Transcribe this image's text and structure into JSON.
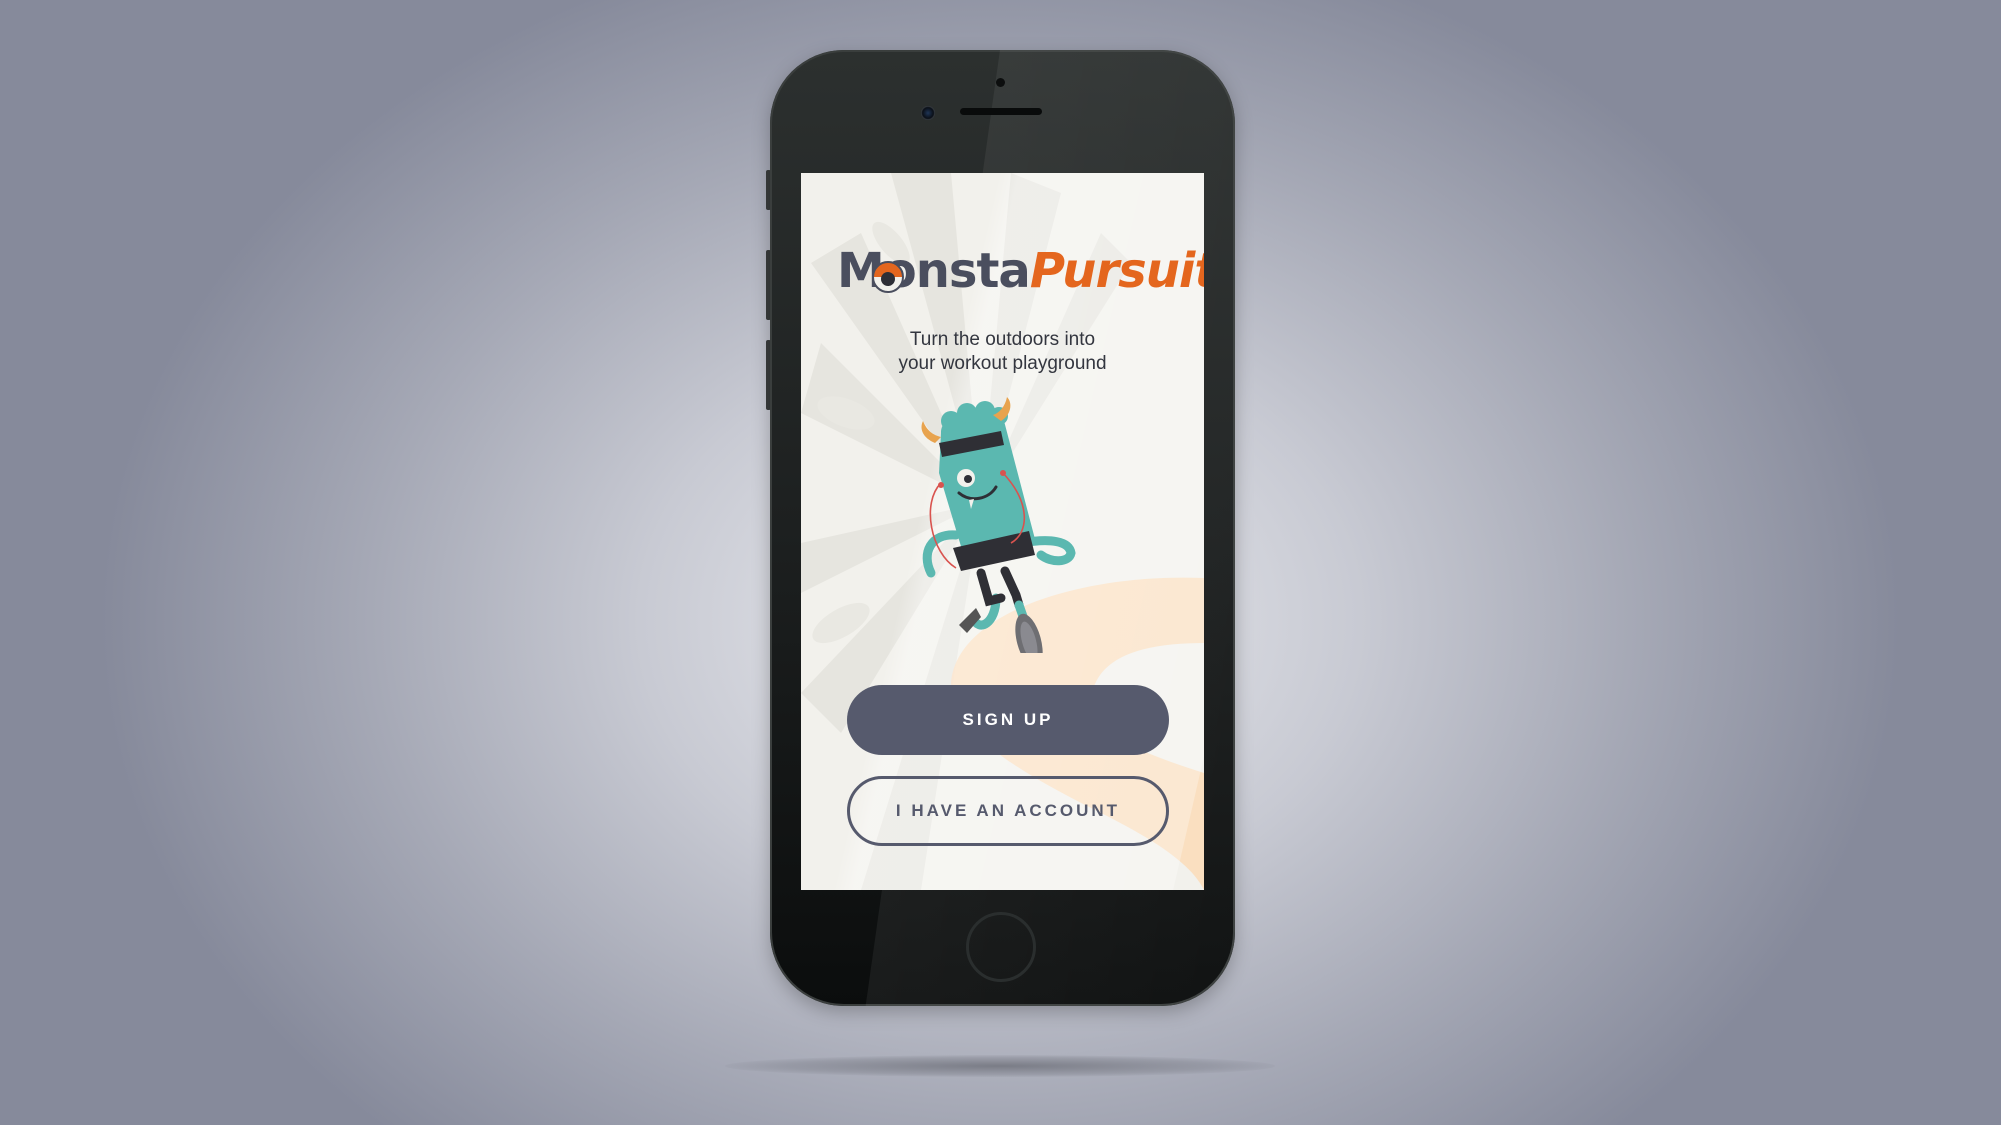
{
  "app": {
    "logo_part_1": "Monsta",
    "logo_part_2": "Pursuit",
    "tagline_line_1": "Turn the outdoors into",
    "tagline_line_2": "your workout playground"
  },
  "actions": {
    "sign_up_label": "SIGN UP",
    "have_account_label": "I HAVE AN ACCOUNT"
  },
  "colors": {
    "brand_dark": "#565a6d",
    "brand_orange": "#e4661e",
    "monster_teal": "#5bb8b0",
    "screen_background": "#f2f1ec"
  },
  "icons": {
    "logo_eye": "eye-icon",
    "mascot": "running-monster-illustration"
  }
}
